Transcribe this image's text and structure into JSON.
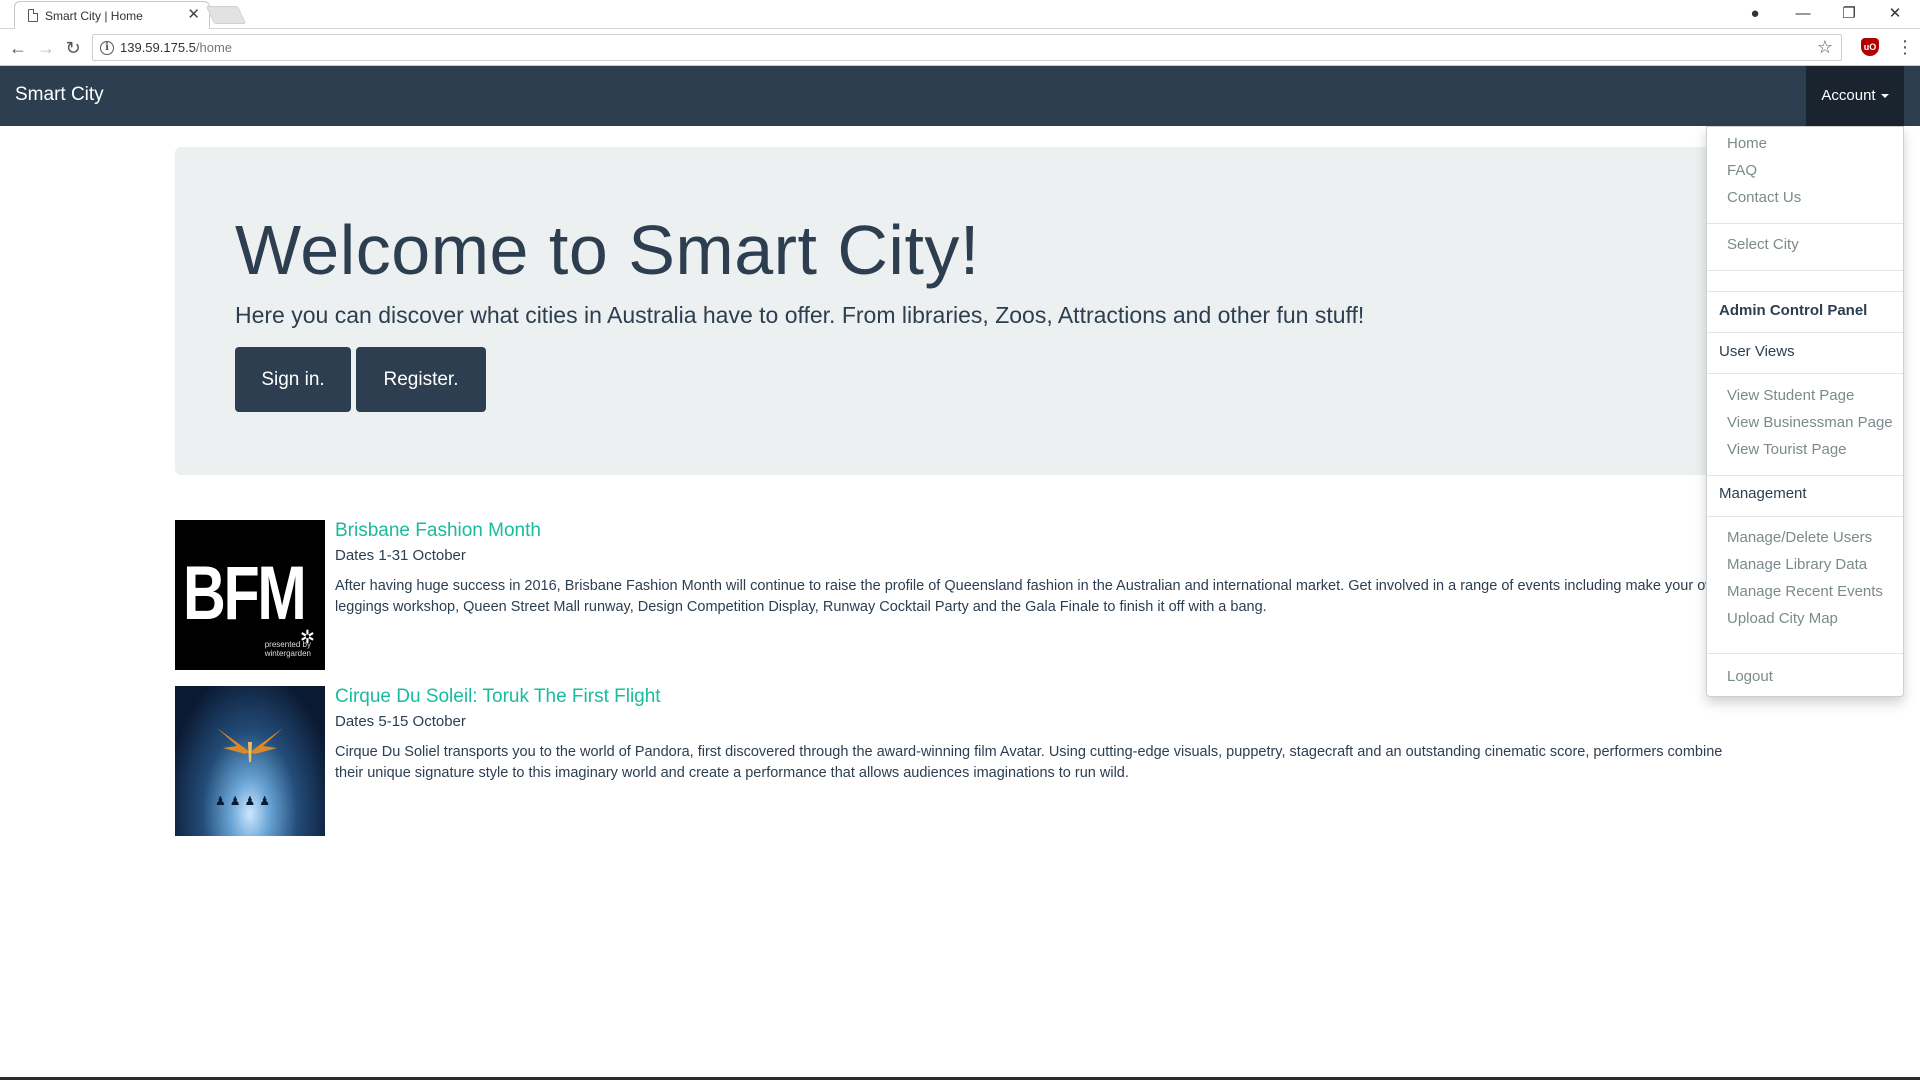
{
  "browser": {
    "tab_title": "Smart City | Home",
    "tab_close": "✕",
    "url_host": "139.59.175.5",
    "url_path": "/home",
    "back": "←",
    "forward": "→",
    "reload": "↻",
    "star": "☆",
    "menu": "⋮",
    "window_controls": {
      "account": "●",
      "minimize": "—",
      "restore": "❐",
      "close": "✕"
    }
  },
  "navbar": {
    "brand": "Smart City",
    "account_label": "Account"
  },
  "hero": {
    "title": "Welcome to Smart City!",
    "lead": "Here you can discover what cities in Australia have to offer. From libraries, Zoos, Attractions and other fun stuff!",
    "signin_label": "Sign in.",
    "register_label": "Register."
  },
  "events": [
    {
      "title": "Brisbane Fashion Month",
      "dates": "Dates 1-31 October",
      "description": "After having huge success in 2016, Brisbane Fashion Month will continue to raise the profile of Queensland fashion in the Australian and international market. Get involved in a range of events including make your own leggings workshop, Queen Street Mall runway, Design Competition Display, Runway Cocktail Party and the Gala Finale to finish it off with a bang.",
      "thumb_text": "BFM",
      "thumb_sub1": "presented by",
      "thumb_sub2": "wintergarden"
    },
    {
      "title": "Cirque Du Soleil: Toruk The First Flight",
      "dates": "Dates 5-15 October",
      "description": "Cirque Du Soliel transports you to the world of Pandora, first discovered through the award-winning film Avatar. Using cutting-edge visuals, puppetry, stagecraft and an outstanding cinematic score, performers combine their unique signature style to this imaginary world and create a performance that allows audiences imaginations to run wild."
    }
  ],
  "dropdown": {
    "home": "Home",
    "faq": "FAQ",
    "contact": "Contact Us",
    "select_city": "Select City",
    "admin_header": "Admin Control Panel",
    "user_views_header": "User Views",
    "view_student": "View Student Page",
    "view_businessman": "View Businessman Page",
    "view_tourist": "View Tourist Page",
    "management_header": "Management",
    "manage_users": "Manage/Delete Users",
    "manage_library": "Manage Library Data",
    "manage_events": "Manage Recent Events",
    "upload_map": "Upload City Map",
    "logout": "Logout"
  },
  "colors": {
    "navbar": "#2c3e50",
    "account_active": "#1a242f",
    "jumbotron": "#ecf0f1",
    "link": "#18bc9c",
    "muted": "#7b8a8b"
  }
}
